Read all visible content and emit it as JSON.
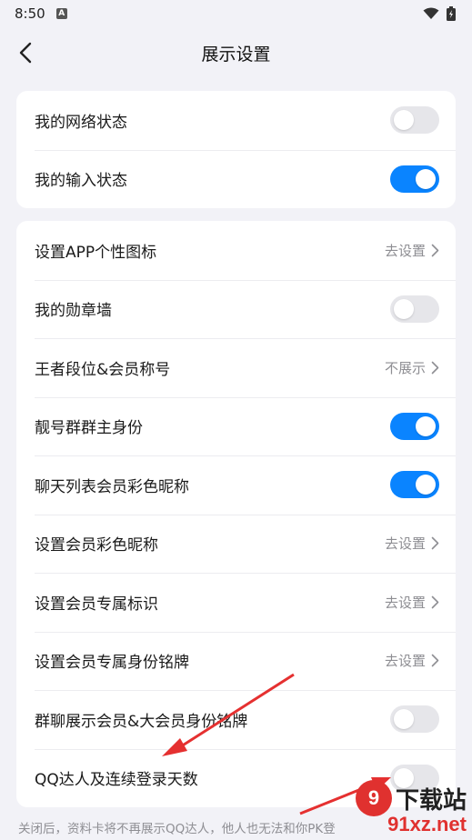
{
  "status_bar": {
    "time": "8:50",
    "notif_letter": "A"
  },
  "nav": {
    "title": "展示设置"
  },
  "card1": {
    "rows": [
      {
        "label": "我的网络状态",
        "toggle": "off"
      },
      {
        "label": "我的输入状态",
        "toggle": "on"
      }
    ]
  },
  "card2": {
    "rows": [
      {
        "label": "设置APP个性图标",
        "link": "去设置"
      },
      {
        "label": "我的勋章墙",
        "toggle": "off"
      },
      {
        "label": "王者段位&会员称号",
        "link": "不展示"
      },
      {
        "label": "靓号群群主身份",
        "toggle": "on"
      },
      {
        "label": "聊天列表会员彩色昵称",
        "toggle": "on"
      },
      {
        "label": "设置会员彩色昵称",
        "link": "去设置"
      },
      {
        "label": "设置会员专属标识",
        "link": "去设置"
      },
      {
        "label": "设置会员专属身份铭牌",
        "link": "去设置"
      },
      {
        "label": "群聊展示会员&大会员身份铭牌",
        "toggle": "off"
      },
      {
        "label": "QQ达人及连续登录天数",
        "toggle": "off"
      }
    ]
  },
  "footnote": "关闭后，资料卡将不再展示QQ达人，他人也无法和你PK登",
  "watermark": {
    "logo": "9",
    "text": "下载站",
    "domain": "91xz.net"
  },
  "colors": {
    "accent": "#0a84ff",
    "toggle_off": "#e6e6ea",
    "background": "#f2f2f7",
    "annotation": "#e53030"
  }
}
